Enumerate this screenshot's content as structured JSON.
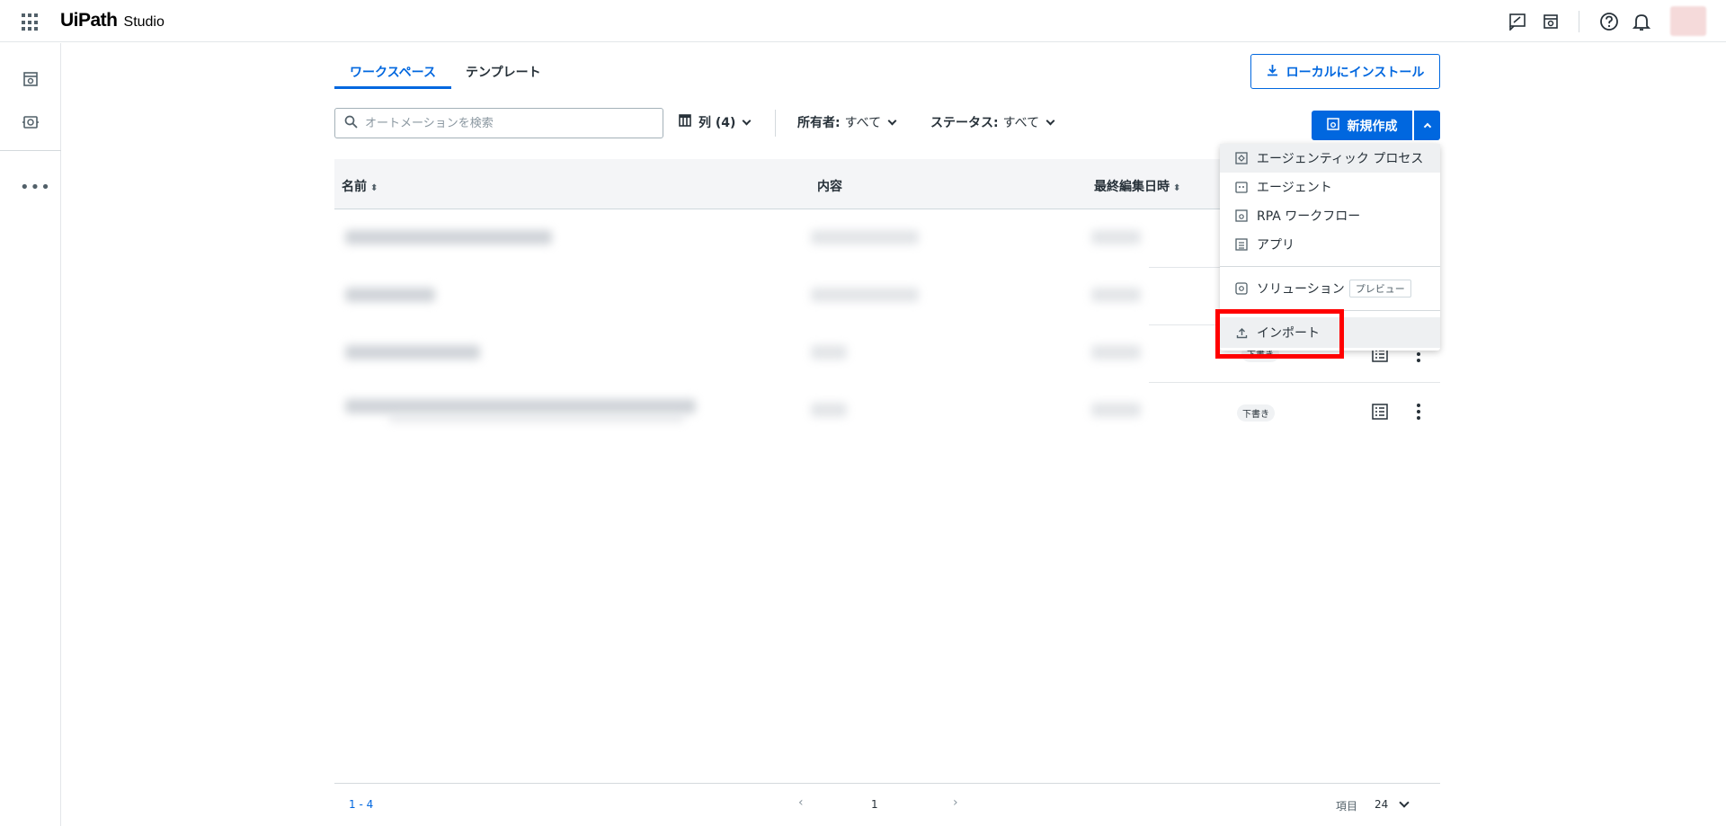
{
  "app": {
    "logo_text": "UiPath",
    "product": "Studio"
  },
  "topbar": {
    "icons": [
      "feedback-icon",
      "studio-icon",
      "help-icon",
      "bell-icon"
    ]
  },
  "leftrail": {
    "icons": [
      "studio-icon",
      "robot-icon"
    ],
    "more": "•••"
  },
  "tabs": [
    {
      "label": "ワークスペース",
      "active": true
    },
    {
      "label": "テンプレート",
      "active": false
    }
  ],
  "install_button": {
    "label": "ローカルにインストール"
  },
  "search": {
    "placeholder": "オートメーションを検索",
    "value": ""
  },
  "filters": {
    "columns_label": "列 (4)",
    "owner_label": "所有者:",
    "owner_value": "すべて",
    "status_label": "ステータス:",
    "status_value": "すべて"
  },
  "new_button": {
    "label": "新規作成"
  },
  "table": {
    "headers": {
      "name": "名前",
      "description": "内容",
      "last_modified": "最終編集日時"
    },
    "rows": [
      {
        "status": ""
      },
      {
        "status": ""
      },
      {
        "status": "下書き"
      },
      {
        "status": "下書き"
      }
    ]
  },
  "dropdown": {
    "items": [
      {
        "label": "エージェンティック プロセス",
        "icon": "agentic-process-icon"
      },
      {
        "label": "エージェント",
        "icon": "agent-icon"
      },
      {
        "label": "RPA ワークフロー",
        "icon": "rpa-workflow-icon"
      },
      {
        "label": "アプリ",
        "icon": "app-icon"
      }
    ],
    "solution": {
      "label": "ソリューション",
      "tag": "プレビュー",
      "icon": "solution-icon"
    },
    "import": {
      "label": "インポート",
      "icon": "upload-icon"
    }
  },
  "pagination": {
    "range": "1 - 4",
    "prev": "‹",
    "page": "1",
    "next": "›",
    "items_label": "項目",
    "page_size": "24"
  },
  "colors": {
    "accent": "#0067df",
    "highlight": "#ff0000"
  }
}
